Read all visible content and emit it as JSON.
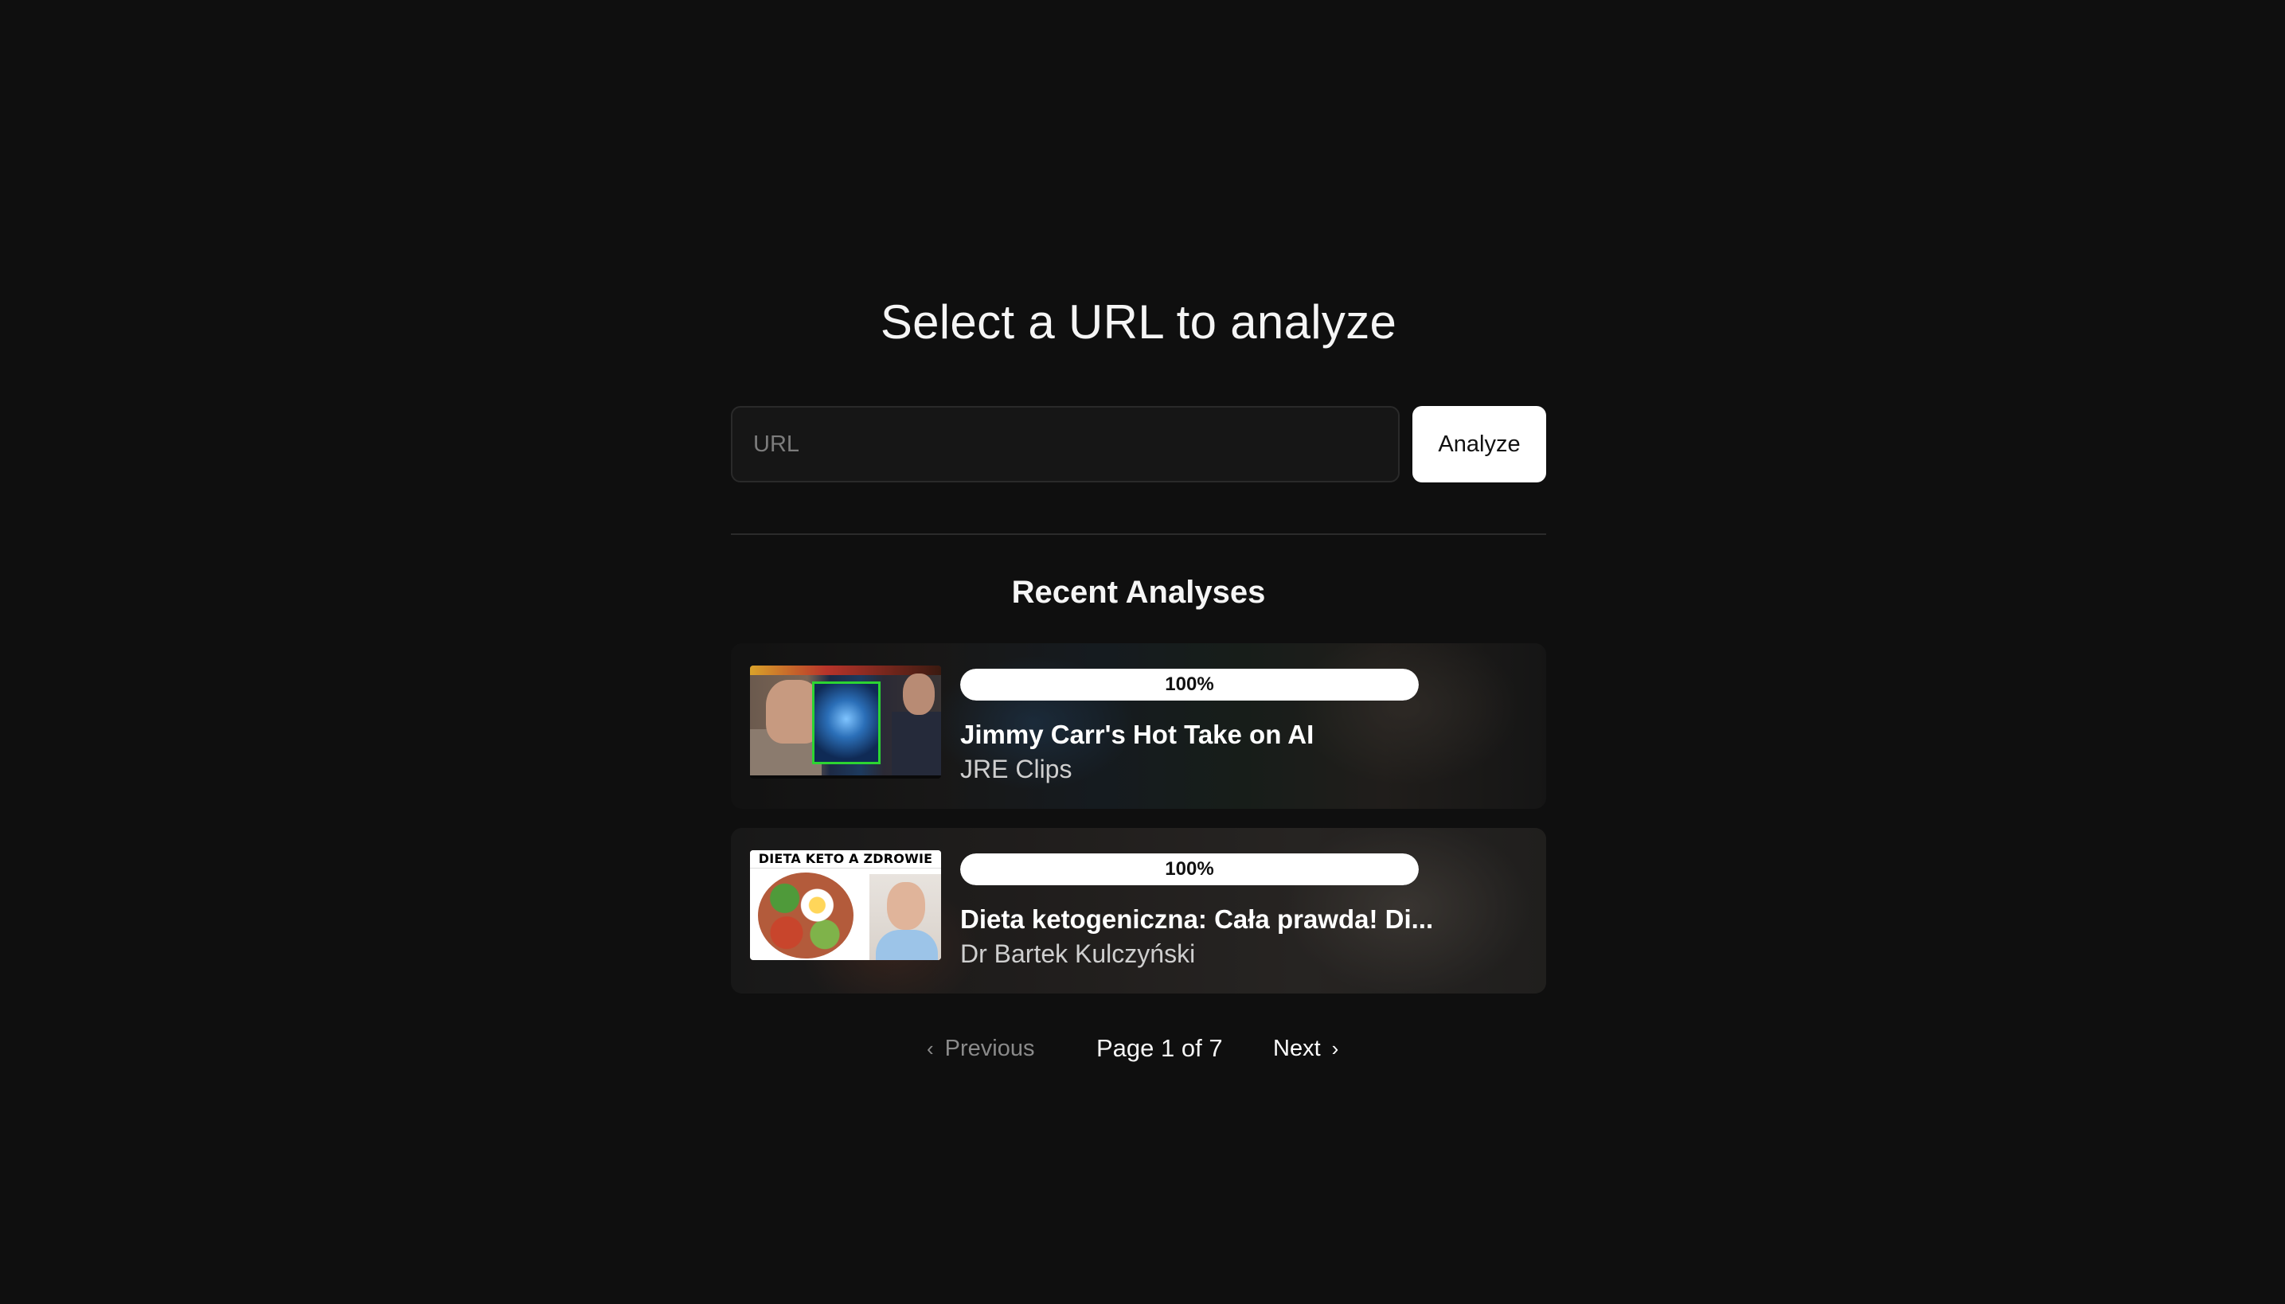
{
  "header": {
    "title": "Select a URL to analyze"
  },
  "search": {
    "placeholder": "URL",
    "value": "",
    "button_label": "Analyze"
  },
  "recent": {
    "heading": "Recent Analyses",
    "items": [
      {
        "progress_label": "100%",
        "progress": 1.0,
        "title": "Jimmy Carr's Hot Take on AI",
        "channel": "JRE Clips",
        "thumbnail_icon": "video-thumbnail"
      },
      {
        "progress_label": "100%",
        "progress": 1.0,
        "title": "Dieta ketogeniczna: Cała prawda! Di...",
        "channel": "Dr Bartek Kulczyński",
        "thumbnail_text": "DIETA KETO A ZDROWIE",
        "thumbnail_icon": "video-thumbnail"
      }
    ]
  },
  "pagination": {
    "prev_label": "Previous",
    "next_label": "Next",
    "page_info": "Page 1 of 7",
    "current_page": 1,
    "total_pages": 7,
    "prev_icon": "chevron-left-icon",
    "next_icon": "chevron-right-icon"
  },
  "colors": {
    "background": "#0f0f0f",
    "button_bg": "#ffffff",
    "text": "#ffffff",
    "muted_text": "#8a8a8a",
    "thumbnail_frame": "#2cd432"
  }
}
